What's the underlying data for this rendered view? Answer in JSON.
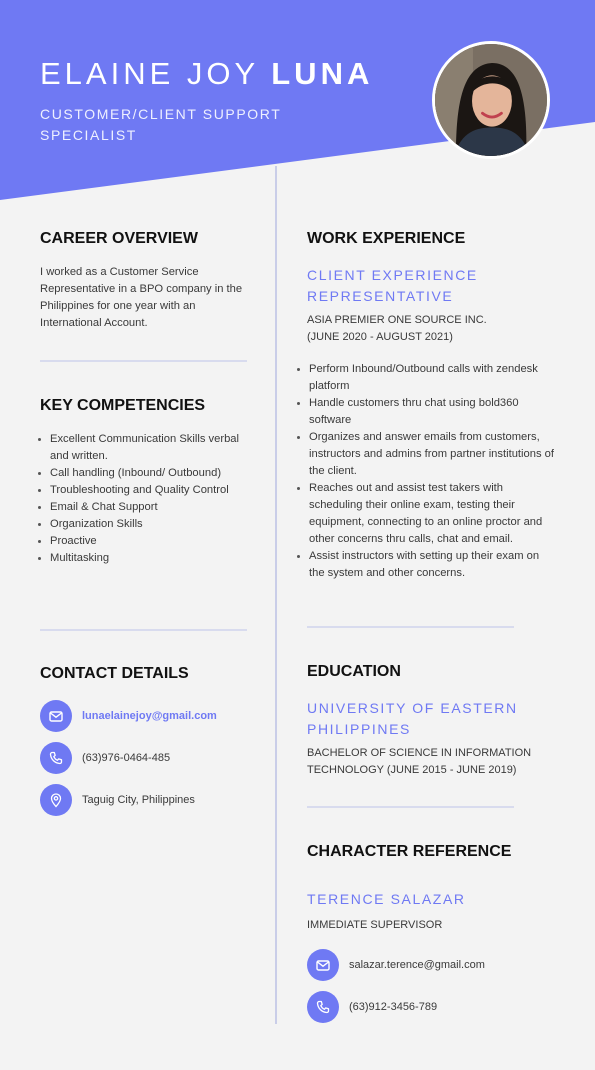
{
  "header": {
    "name_first": "ELAINE JOY",
    "name_last": "LUNA",
    "title": "CUSTOMER/CLIENT SUPPORT SPECIALIST"
  },
  "colors": {
    "accent": "#6f79f3",
    "background": "#f3f3f3",
    "heading": "#111111"
  },
  "career_overview": {
    "heading": "CAREER OVERVIEW",
    "text": "I worked as a Customer Service Representative in a BPO company in the  Philippines for one year with an International Account."
  },
  "key_competencies": {
    "heading": "KEY COMPETENCIES",
    "items": [
      "Excellent Communication Skills verbal and written.",
      "Call handling (Inbound/ Outbound)",
      "Troubleshooting and Quality Control",
      "Email & Chat Support",
      "Organization Skills",
      "Proactive",
      "Multitasking"
    ]
  },
  "contact_details": {
    "heading": "CONTACT DETAILS",
    "email": "lunaelainejoy@gmail.com",
    "phone": "(63)976-0464-485",
    "location": "Taguig City, Philippines",
    "icons": [
      "mail-icon",
      "phone-icon",
      "location-pin-icon"
    ]
  },
  "work_experience": {
    "heading": "WORK EXPERIENCE",
    "role": "CLIENT EXPERIENCE REPRESENTATIVE",
    "company": "ASIA PREMIER ONE SOURCE INC.",
    "dates": "(JUNE 2020 - AUGUST 2021)",
    "duties": [
      "Perform Inbound/Outbound calls with zendesk platform",
      "Handle customers thru chat using bold360 software",
      "Organizes and answer emails from customers, instructors and admins from partner institutions of the client.",
      "Reaches out and assist test takers with scheduling their online exam, testing their equipment, connecting to an online proctor and other concerns thru calls, chat and email.",
      "Assist instructors with setting up their exam on the system and other concerns."
    ]
  },
  "education": {
    "heading": "EDUCATION",
    "school": "UNIVERSITY OF EASTERN PHILIPPINES",
    "degree": "BACHELOR OF SCIENCE IN INFORMATION TECHNOLOGY (JUNE 2015 - JUNE 2019)"
  },
  "character_reference": {
    "heading": "CHARACTER REFERENCE",
    "name": "TERENCE SALAZAR",
    "position": "IMMEDIATE SUPERVISOR",
    "email": "salazar.terence@gmail.com",
    "phone": "(63)912-3456-789"
  }
}
